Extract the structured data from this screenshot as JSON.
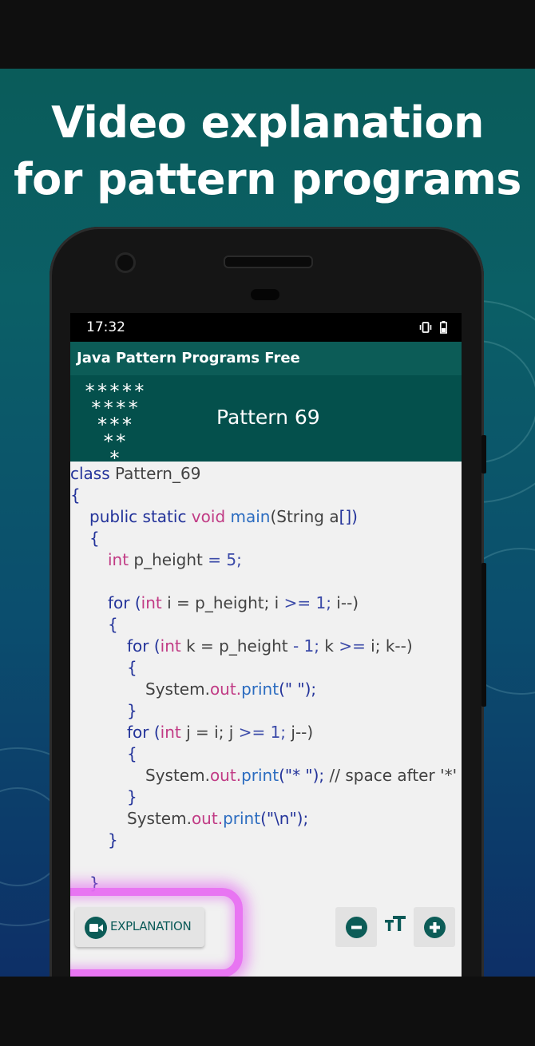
{
  "headline": {
    "line1": "Video explanation",
    "line2": "for pattern programs"
  },
  "status_bar": {
    "time": "17:32"
  },
  "app_bar": {
    "title": "Java Pattern Programs Free"
  },
  "pattern": {
    "title": "Pattern 69",
    "preview_rows": [
      "*****",
      "****",
      "***",
      "**",
      "*"
    ]
  },
  "code": {
    "l1": {
      "a": "class",
      "b": " Pattern_69"
    },
    "l2": {
      "a": "{"
    },
    "l3": {
      "a": "public static",
      "b": " void",
      "c": " main",
      "d": "(String a",
      "e": "[])"
    },
    "l4": {
      "a": "{"
    },
    "l5": {
      "a": "int",
      "b": " p_height ",
      "c": "= 5;"
    },
    "l7": {
      "a": "for (",
      "b": "int",
      "c": " i = p_height; i ",
      "d": ">= 1;",
      "e": " i--)"
    },
    "l8": {
      "a": "{"
    },
    "l9": {
      "a": "for (",
      "b": "int",
      "c": " k = p_height ",
      "d": "- 1;",
      "e": " k ",
      "f": ">=",
      "g": " i; k--)"
    },
    "l10": {
      "a": "{"
    },
    "l11": {
      "a": "System.",
      "b": "out.",
      "c": "print",
      "d": "(\" \");"
    },
    "l12": {
      "a": "}"
    },
    "l13": {
      "a": "for (",
      "b": "int",
      "c": " j = i; j ",
      "d": ">= 1;",
      "e": " j--)"
    },
    "l14": {
      "a": "{"
    },
    "l15": {
      "a": "System.",
      "b": "out.",
      "c": "print",
      "d": "(\"* \");",
      "e": " // space after '*'"
    },
    "l16": {
      "a": "}"
    },
    "l17": {
      "a": "System.",
      "b": "out.",
      "c": "print",
      "d": "(\"\\n\");"
    },
    "l18": {
      "a": "}"
    },
    "l20": {
      "a": "}"
    }
  },
  "controls": {
    "explanation_label": "EXPLANATION",
    "text_size_glyph": "TT"
  },
  "colors": {
    "accent": "#0c5c57",
    "header_dark": "#04504c",
    "highlight_glow": "#e76ef1",
    "keyword": "#23339a",
    "type": "#c13b85"
  },
  "icons": {
    "video": "video-camera-icon",
    "zoom_out": "minus-circle-icon",
    "zoom_in": "plus-circle-icon",
    "text_size": "text-size-icon",
    "vibrate": "vibrate-icon",
    "battery": "battery-icon"
  }
}
